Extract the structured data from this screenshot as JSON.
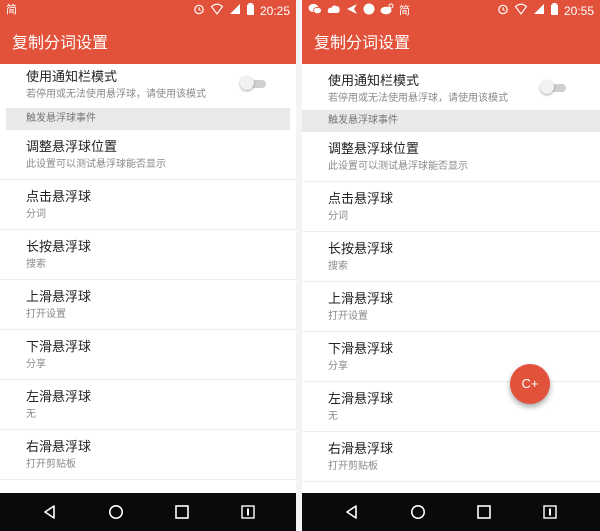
{
  "app": {
    "title": "复制分词设置"
  },
  "status_left": {
    "icon_label": "简",
    "time": "20:25"
  },
  "status_right": {
    "icon_label": "简",
    "time": "20:55"
  },
  "notification_mode": {
    "title": "使用通知栏模式",
    "subtitle": "若停用或无法使用悬浮球，请使用该模式",
    "enabled": false
  },
  "section": {
    "label": "触发悬浮球事件"
  },
  "items": [
    {
      "title": "调整悬浮球位置",
      "subtitle": "此设置可以测试悬浮球能否显示"
    },
    {
      "title": "点击悬浮球",
      "subtitle": "分词"
    },
    {
      "title": "长按悬浮球",
      "subtitle": "搜索"
    },
    {
      "title": "上滑悬浮球",
      "subtitle": "打开设置"
    },
    {
      "title": "下滑悬浮球",
      "subtitle": "分享"
    },
    {
      "title": "左滑悬浮球",
      "subtitle": "无"
    },
    {
      "title": "右滑悬浮球",
      "subtitle": "打开剪贴板"
    }
  ],
  "fab": {
    "label": "C+"
  },
  "colors": {
    "accent": "#e2523a",
    "navbar": "#0a0a0a",
    "section_bg": "#e9e9e9"
  },
  "icons": {
    "status_left": [
      "text-icon",
      "alarm-icon",
      "wifi-icon",
      "signal-icon",
      "battery-icon"
    ],
    "status_right": [
      "wechat-icon",
      "cloud-icon",
      "send-icon",
      "circle-icon",
      "weibo-icon",
      "text-icon",
      "alarm-icon",
      "wifi-icon",
      "signal-icon",
      "battery-icon"
    ],
    "navbar": [
      "back-icon",
      "home-icon",
      "recents-icon",
      "menu-icon"
    ]
  }
}
